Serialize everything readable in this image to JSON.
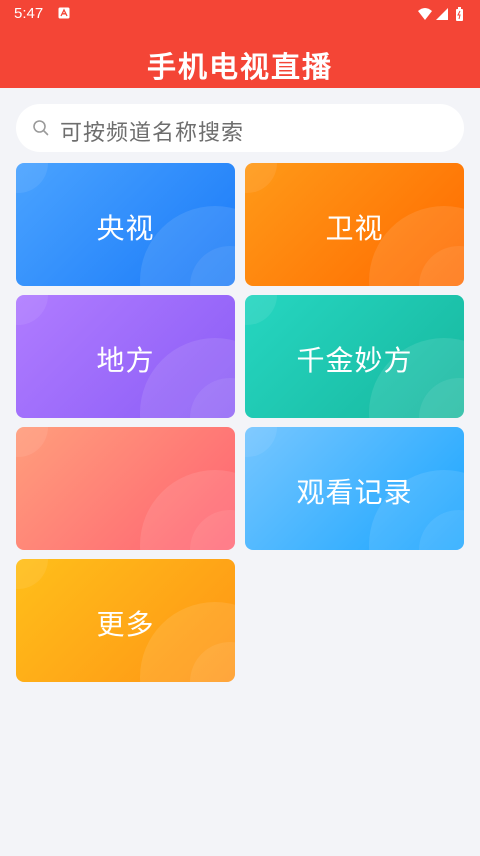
{
  "status_bar": {
    "time": "5:47"
  },
  "header": {
    "title": "手机电视直播"
  },
  "search": {
    "placeholder": "可按频道名称搜索"
  },
  "tiles": [
    {
      "label": "央视",
      "color_start": "#4aa3ff",
      "color_end": "#1a7af8"
    },
    {
      "label": "卫视",
      "color_start": "#ff9a18",
      "color_end": "#ff6a00"
    },
    {
      "label": "地方",
      "color_start": "#b07cff",
      "color_end": "#8a5cf6"
    },
    {
      "label": "千金妙方",
      "color_start": "#26d6c1",
      "color_end": "#17b79e"
    },
    {
      "label": "",
      "color_start": "#ff9e7c",
      "color_end": "#ff6272"
    },
    {
      "label": "观看记录",
      "color_start": "#76c6ff",
      "color_end": "#1aa5ff"
    },
    {
      "label": "更多",
      "color_start": "#ffbf1a",
      "color_end": "#ff9415"
    }
  ],
  "colors": {
    "header_bg": "#f44536",
    "page_bg": "#f3f4f8"
  },
  "icons": {
    "status_left": "app-notification-icon",
    "status_right": [
      "wifi-icon",
      "signal-icon",
      "battery-icon"
    ],
    "search": "search-icon"
  }
}
